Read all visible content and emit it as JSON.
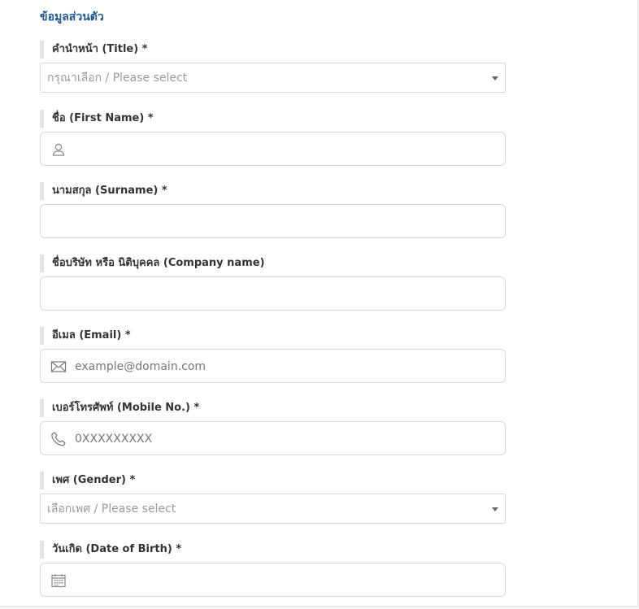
{
  "section": {
    "title": "ข้อมูลส่วนตัว"
  },
  "fields": {
    "title": {
      "label": "คำนำหน้า (Title) *",
      "selected": "กรุณาเลือก / Please select"
    },
    "first_name": {
      "label": "ชื่อ (First Name) *",
      "icon": "user-icon"
    },
    "surname": {
      "label": "นามสกุล (Surname) *"
    },
    "company": {
      "label": "ชื่อบริษัท หรือ นิติบุคคล (Company name)"
    },
    "email": {
      "label": "อีเมล (Email) *",
      "placeholder": "example@domain.com",
      "icon": "mail-icon"
    },
    "mobile": {
      "label": "เบอร์โทรศัพท์ (Mobile No.) *",
      "placeholder": "0XXXXXXXXX",
      "icon": "phone-icon"
    },
    "gender": {
      "label": "เพศ (Gender) *",
      "selected": "เลือกเพศ / Please select"
    },
    "dob": {
      "label": "วันเกิด (Date of Birth) *",
      "icon": "calendar-icon"
    }
  }
}
